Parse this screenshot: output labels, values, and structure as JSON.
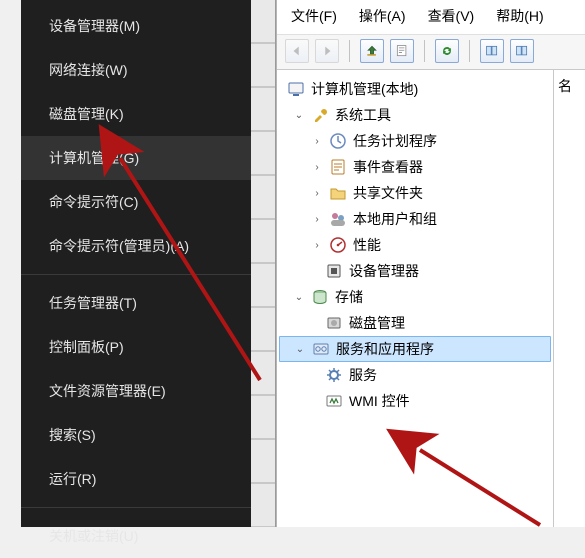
{
  "context_menu": {
    "items": [
      {
        "label": "设备管理器(M)"
      },
      {
        "label": "网络连接(W)"
      },
      {
        "label": "磁盘管理(K)"
      },
      {
        "label": "计算机管理(G)",
        "highlight": true
      },
      {
        "label": "命令提示符(C)"
      },
      {
        "label": "命令提示符(管理员)(A)"
      }
    ],
    "items2": [
      {
        "label": "任务管理器(T)"
      },
      {
        "label": "控制面板(P)"
      },
      {
        "label": "文件资源管理器(E)"
      },
      {
        "label": "搜索(S)"
      },
      {
        "label": "运行(R)"
      }
    ],
    "items3": [
      {
        "label": "关机或注销(U)"
      }
    ]
  },
  "menubar": {
    "file": "文件(F)",
    "action": "操作(A)",
    "view": "查看(V)",
    "help": "帮助(H)"
  },
  "tree": {
    "root": "计算机管理(本地)",
    "system_tools": "系统工具",
    "task_scheduler": "任务计划程序",
    "event_viewer": "事件查看器",
    "shared_folders": "共享文件夹",
    "local_users": "本地用户和组",
    "performance": "性能",
    "device_manager": "设备管理器",
    "storage": "存储",
    "disk_mgmt": "磁盘管理",
    "services_apps": "服务和应用程序",
    "services": "服务",
    "wmi": "WMI 控件"
  },
  "side": {
    "label": "名"
  },
  "svg": {
    "computer": "<rect x='2' y='3' width='14' height='10' rx='1' fill='#f4f4f4' stroke='#4b6fa9'/><rect x='6' y='14' width='6' height='2' fill='#4b6fa9'/>",
    "wrench": "<path d='M4 14l5-5 2 2-5 5H4v-2zM13 3a3 3 0 0 0-3 3l3 3a3 3 0 0 0 0-6z' fill='#d8a92a'/>",
    "clock": "<circle cx='9' cy='9' r='7' fill='#fff' stroke='#6a8abf' stroke-width='1.5'/><path d='M9 4v5l3 2' stroke='#6a8abf' stroke-width='1.5' fill='none'/>",
    "event": "<rect x='3' y='2' width='12' height='14' rx='1' fill='#fff' stroke='#b77c2a'/><path d='M5 6h8M5 9h8M5 12h5' stroke='#b77c2a'/>",
    "folder": "<path d='M2 5h5l2 2h7v8H2z' fill='#f4d37a' stroke='#c49a2e'/>",
    "users": "<circle cx='6' cy='6' r='3' fill='#c47a9a'/><circle cx='12' cy='8' r='3' fill='#7aa0c4'/><rect x='2' y='10' width='14' height='6' rx='3' fill='#a8a8a8'/>",
    "perf": "<circle cx='9' cy='9' r='7' fill='#fff' stroke='#b03030' stroke-width='1.5'/><path d='M9 9l4-3' stroke='#b03030' stroke-width='1.5'/><circle cx='9' cy='9' r='1.3' fill='#b03030'/>",
    "device": "<rect x='3' y='3' width='12' height='12' rx='1' fill='#e8e8e8' stroke='#555'/><rect x='6' y='6' width='6' height='6' fill='#555'/>",
    "storage": "<ellipse cx='9' cy='5' rx='6' ry='2.5' fill='#a0c4a0' stroke='#4a8a4a'/><path d='M3 5v8a6 2.5 0 0 0 12 0V5' fill='#cde5cd' stroke='#4a8a4a'/>",
    "disk": "<rect x='3' y='4' width='12' height='10' rx='1' fill='#d8d8d8' stroke='#666'/><circle cx='9' cy='9' r='3' fill='#aaa'/>",
    "gearbox": "<rect x='2' y='4' width='14' height='10' rx='1' fill='#e0eaf5' stroke='#5a7fb5'/><circle cx='6' cy='9' r='2.2' fill='none' stroke='#5a7fb5'/><circle cx='12' cy='9' r='2.2' fill='none' stroke='#5a7fb5'/>",
    "gear": "<circle cx='9' cy='9' r='4' fill='none' stroke='#5a7fb5' stroke-width='2'/><path d='M9 2v3M9 13v3M2 9h3M13 9h3M4 4l2 2M12 12l2 2M14 4l-2 2M6 12l-2 2' stroke='#5a7fb5' stroke-width='1.5'/>",
    "wmi": "<rect x='2' y='4' width='14' height='10' rx='1' fill='#fff' stroke='#777'/><path d='M5 11l2-4 2 4 2-4 2 4' stroke='#3a7a3a' fill='none' stroke-width='1.3'/>",
    "back": "<path d='M9 3L3 8l6 5V3z' fill='currentColor'/>",
    "fwd": "<path d='M5 3l6 5-6 5V3z' fill='currentColor'/>",
    "up": "<path d='M7 12V7H4l5-5 5 5h-3v5H7z' fill='#3a7a3a' stroke='#2a5a2a'/><rect x='3' y='12' width='11' height='2' fill='#c49a2e'/>",
    "props": "<rect x='3' y='2' width='11' height='13' fill='#fff' stroke='#888'/><path d='M5 5h7M5 8h7M5 11h4' stroke='#888'/>",
    "refresh": "<path d='M4 9a5 5 0 0 1 9-3l1-1v4h-4l1.5-1.5A3.5 3.5 0 0 0 5.5 9' fill='#2a8a2a'/><path d='M14 9a5 5 0 0 1-9 3l-1 1v-4h4l-1.5 1.5A3.5 3.5 0 0 0 12.5 9' fill='#2a8a2a'/>",
    "panes": "<rect x='2' y='3' width='6' height='11' fill='#cfe3f7' stroke='#4b7ab0'/><rect x='9' y='3' width='6' height='11' fill='#cfe3f7' stroke='#4b7ab0'/>"
  }
}
